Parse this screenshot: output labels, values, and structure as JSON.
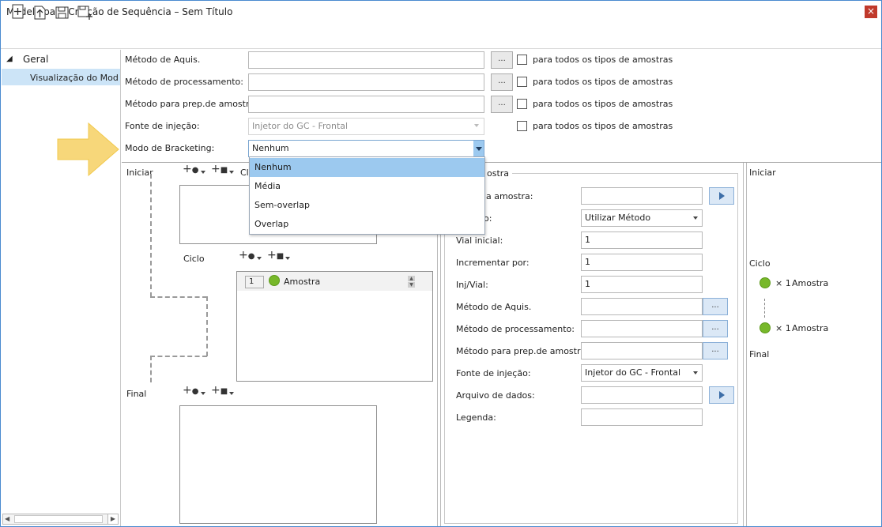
{
  "window": {
    "title": "Modelo para Criação de Sequência – Sem Título",
    "close_glyph": "×"
  },
  "toolbar": {
    "buttons": [
      "new-icon",
      "import-icon",
      "save-icon",
      "save-as-icon"
    ]
  },
  "tree": {
    "root_label": "Geral",
    "child_label": "Visualização do Modelo",
    "expand_glyph": "◢"
  },
  "form": {
    "acq_label": "Método de Aquis.",
    "proc_label": "Método de processamento:",
    "prep_label": "Método para prep.de amostra:",
    "inj_label": "Fonte de injeção:",
    "inj_value": "Injetor do GC - Frontal",
    "bracket_label": "Modo de Bracketing:",
    "bracket_value": "Nenhum",
    "all_types_label": "para todos os tipos de amostras",
    "ellipsis": "..."
  },
  "bracket_options": [
    "Nenhum",
    "Média",
    "Sem-overlap",
    "Overlap"
  ],
  "sequence": {
    "start_label": "Iniciar",
    "cycle_label": "Ciclo",
    "final_label": "Final",
    "cycle_row_num": "1",
    "cycle_row_name": "Amostra",
    "partial_label_c": "Cl"
  },
  "details": {
    "group_title": "ostra",
    "sample_name_label": "la amostra:",
    "method_label_partial": "o:",
    "method_value": "Utilizar Método",
    "vial_label": "Vial inicial:",
    "vial_value": "1",
    "incr_label": "Incrementar por:",
    "incr_value": "1",
    "injvial_label": "Inj/Vial:",
    "injvial_value": "1",
    "acq_label": "Método de Aquis.",
    "proc_label": "Método de processamento:",
    "prep_label": "Método para prep.de amostra:",
    "inj_label": "Fonte de injeção:",
    "inj_value": "Injetor do GC - Frontal",
    "datafile_label": "Arquivo de dados:",
    "caption_label": "Legenda:",
    "ellipsis": "..."
  },
  "preview": {
    "start_label": "Iniciar",
    "cycle_label": "Ciclo",
    "final_label": "Final",
    "item1_mult": "× 1",
    "item1_name": "Amostra",
    "item2_mult": "× 1",
    "item2_name": "Amostra"
  },
  "colors": {
    "accent": "#9cc9ef",
    "tree_selection": "#cce4f7",
    "sample_dot": "#77b82a",
    "callout_arrow": "#f7d77a"
  }
}
